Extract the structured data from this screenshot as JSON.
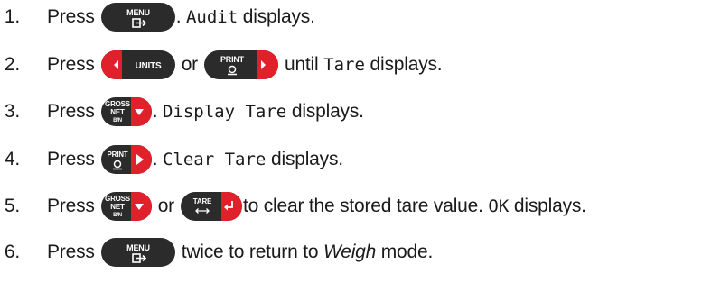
{
  "steps": [
    {
      "number": "1.",
      "press": "Press",
      "key1": {
        "label": "MENU",
        "icon": "exit-arrow-icon"
      },
      "text_a": ". ",
      "mono_a": "Audit",
      "text_b": " displays."
    },
    {
      "number": "2.",
      "press": "Press",
      "key1": {
        "label": "UNITS",
        "icon": "left-arrow-icon"
      },
      "or": "or",
      "key2": {
        "label": "PRINT",
        "icon": "print-icon"
      },
      "text_a": "until ",
      "mono_a": "Tare",
      "text_b": " displays."
    },
    {
      "number": "3.",
      "press": "Press",
      "key1": {
        "label_top": "GROSS",
        "label_mid": "NET",
        "label_bot": "B/N",
        "icon": "down-arrow-icon"
      },
      "text_a": ". ",
      "mono_a": "Display Tare",
      "text_b": " displays."
    },
    {
      "number": "4.",
      "press": "Press",
      "key1": {
        "label": "PRINT",
        "icon": "print-icon"
      },
      "text_a": ". ",
      "mono_a": "Clear Tare",
      "text_b": " displays."
    },
    {
      "number": "5.",
      "press": "Press",
      "key1": {
        "label_top": "GROSS",
        "label_mid": "NET",
        "label_bot": "B/N",
        "icon": "down-arrow-icon"
      },
      "or": "or",
      "key2": {
        "label": "TARE",
        "icon": "enter-arrow-icon"
      },
      "text_a": " to clear the stored tare value. ",
      "mono_a": "OK",
      "text_b": " displays."
    },
    {
      "number": "6.",
      "press": "Press",
      "key1": {
        "label": "MENU",
        "icon": "exit-arrow-icon"
      },
      "text_a": "twice to return to ",
      "ital_a": "Weigh",
      "text_b": " mode."
    }
  ],
  "colors": {
    "key_body": "#2b2b2b",
    "key_accent": "#e0202a",
    "text": "#1a1a1a"
  }
}
